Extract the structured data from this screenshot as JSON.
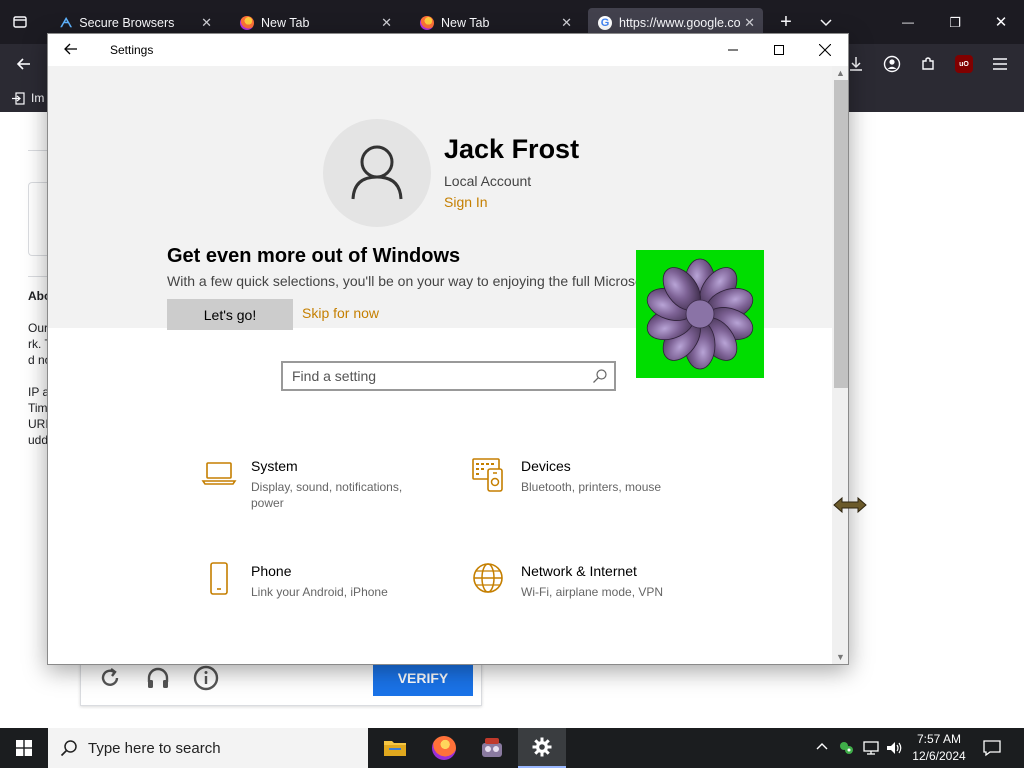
{
  "browser": {
    "tabs": [
      {
        "label": "Secure Browsers",
        "icon": "secure-browsers-favicon"
      },
      {
        "label": "New Tab",
        "icon": "firefox-icon"
      },
      {
        "label": "New Tab",
        "icon": "firefox-icon"
      },
      {
        "label": "https://www.google.co",
        "icon": "google-icon"
      }
    ],
    "bookmark_label": "Im",
    "window_buttons": {
      "minimize": "—",
      "restore": "❐",
      "close": "✕"
    }
  },
  "background_page": {
    "about_label": "Abo",
    "text_lines": [
      "Our",
      "rk. T",
      "d no",
      "IP a",
      "Tim",
      "URI",
      "udd"
    ],
    "verify_label": "VERIFY"
  },
  "settings": {
    "window_title": "Settings",
    "user": {
      "name": "Jack Frost",
      "account_type": "Local Account",
      "sign_in_link": "Sign In"
    },
    "promo": {
      "title": "Get even more out of Windows",
      "description": "With a few quick selections, you'll be on your way to enjoying the full Microsoft experience.",
      "primary_button": "Let's go!",
      "secondary_link": "Skip for now"
    },
    "search": {
      "placeholder": "Find a setting"
    },
    "categories": [
      {
        "name": "System",
        "description": "Display, sound, notifications, power",
        "icon": "laptop-icon"
      },
      {
        "name": "Devices",
        "description": "Bluetooth, printers, mouse",
        "icon": "devices-icon"
      },
      {
        "name": "Phone",
        "description": "Link your Android, iPhone",
        "icon": "phone-icon"
      },
      {
        "name": "Network & Internet",
        "description": "Wi-Fi, airplane mode, VPN",
        "icon": "globe-icon"
      }
    ],
    "accent_color": "#c57f00"
  },
  "taskbar": {
    "search_placeholder": "Type here to search",
    "apps": [
      "file-explorer-icon",
      "firefox-icon",
      "app-icon",
      "settings-gear-icon"
    ],
    "time": "7:57 AM",
    "date": "12/6/2024"
  }
}
